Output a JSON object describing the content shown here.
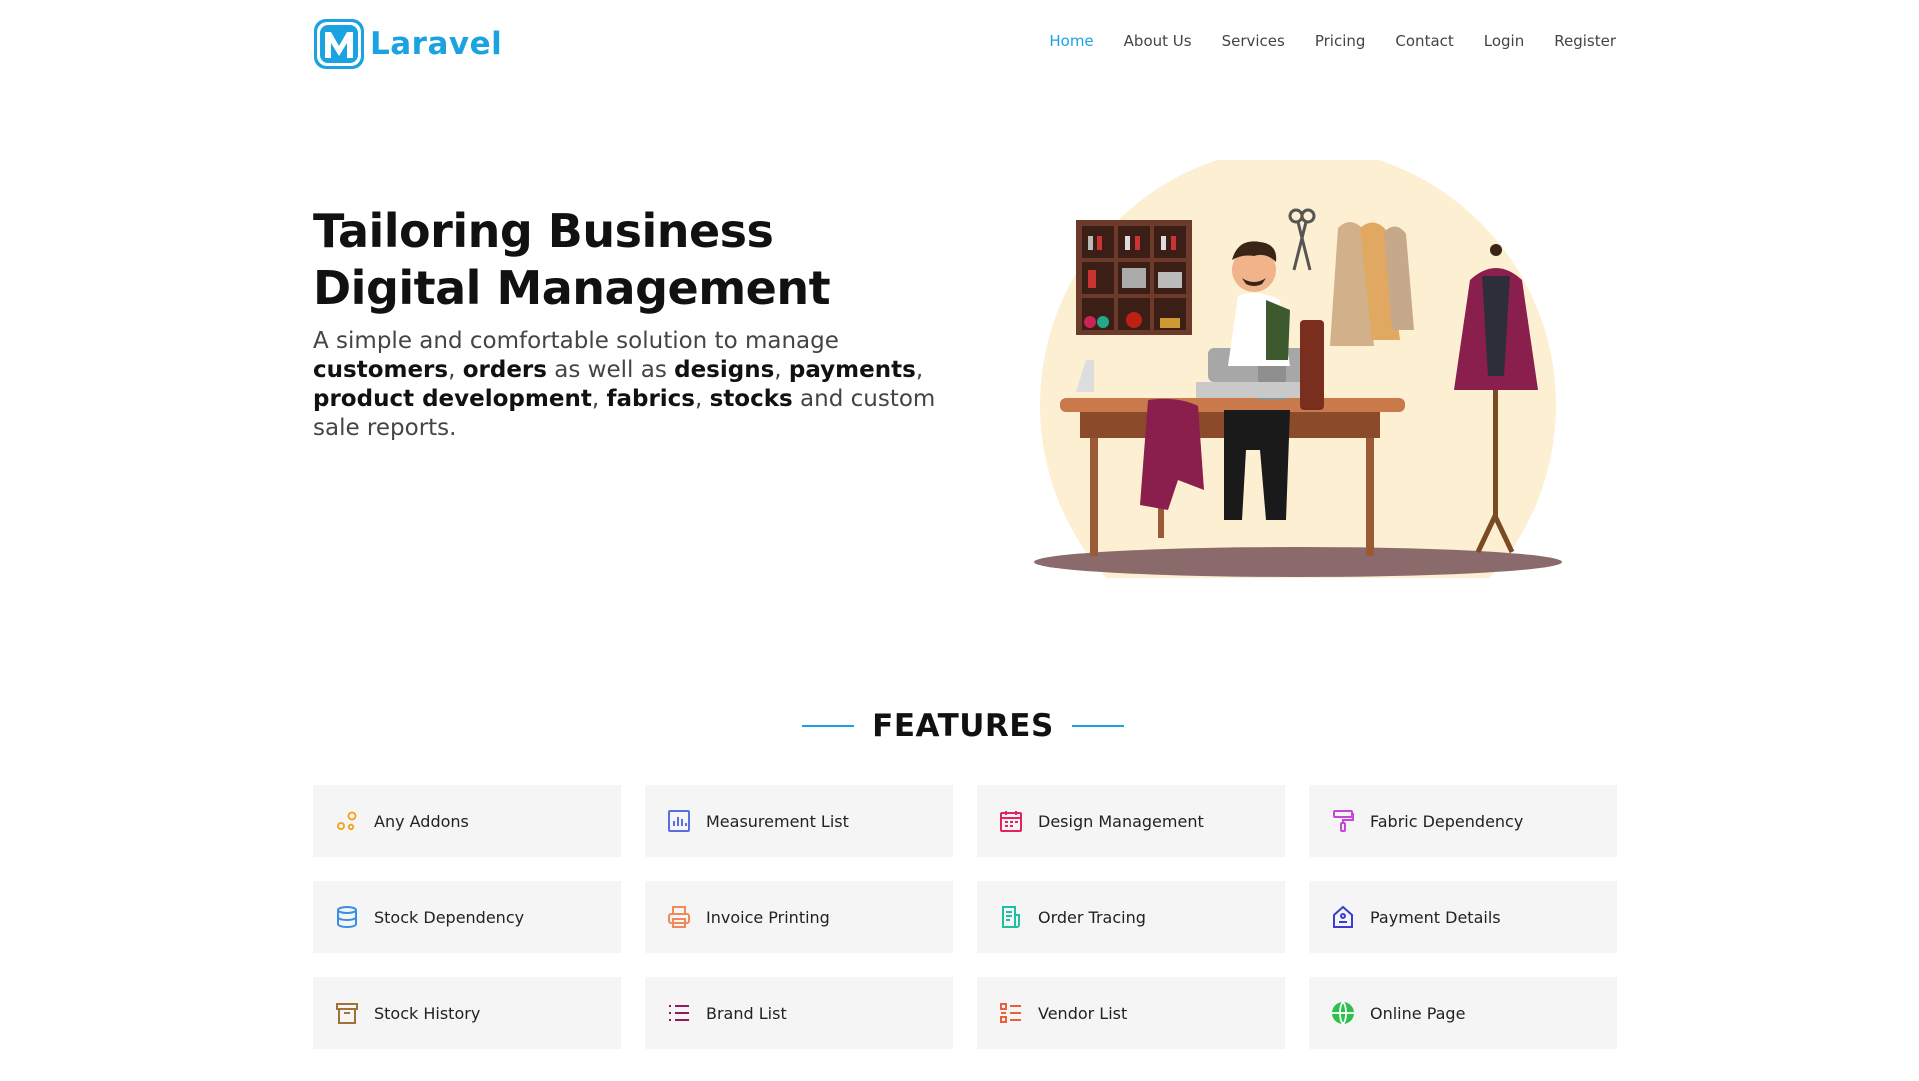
{
  "brand": {
    "name": "Laravel",
    "color": "#1aa3e0"
  },
  "nav": [
    {
      "label": "Home",
      "active": true
    },
    {
      "label": "About Us"
    },
    {
      "label": "Services"
    },
    {
      "label": "Pricing"
    },
    {
      "label": "Contact"
    },
    {
      "label": "Login"
    },
    {
      "label": "Register"
    }
  ],
  "hero": {
    "title": "Tailoring Business Digital Management",
    "desc": {
      "p1": "A simple and comfortable solution to manage ",
      "b1": "customers",
      "p2": ", ",
      "b2": "orders",
      "p3": " as well as ",
      "b3": "designs",
      "p4": ", ",
      "b4": "payments",
      "p5": ", ",
      "b5": "product development",
      "p6": ", ",
      "b6": "fabrics",
      "p7": ", ",
      "b7": "stocks",
      "p8": " and custom sale reports."
    }
  },
  "features": {
    "heading": "FEATURES",
    "items": [
      {
        "label": "Any Addons",
        "icon": "addons-icon",
        "color": "#f5a623"
      },
      {
        "label": "Measurement List",
        "icon": "bar-chart-icon",
        "color": "#5b6ee1"
      },
      {
        "label": "Design Management",
        "icon": "calendar-icon",
        "color": "#e0245e"
      },
      {
        "label": "Fabric Dependency",
        "icon": "paint-roller-icon",
        "color": "#c548d8"
      },
      {
        "label": "Stock Dependency",
        "icon": "database-icon",
        "color": "#3a8ee6"
      },
      {
        "label": "Invoice Printing",
        "icon": "printer-icon",
        "color": "#f08a5d"
      },
      {
        "label": "Order Tracing",
        "icon": "document-icon",
        "color": "#1fbf9f"
      },
      {
        "label": "Payment Details",
        "icon": "house-payment-icon",
        "color": "#3b3bd6"
      },
      {
        "label": "Stock History",
        "icon": "archive-icon",
        "color": "#a0713a"
      },
      {
        "label": "Brand List",
        "icon": "list-icon",
        "color": "#8e1c5a"
      },
      {
        "label": "Vendor List",
        "icon": "task-list-icon",
        "color": "#e8603c"
      },
      {
        "label": "Online Page",
        "icon": "globe-icon",
        "color": "#2fbf4e"
      }
    ]
  }
}
